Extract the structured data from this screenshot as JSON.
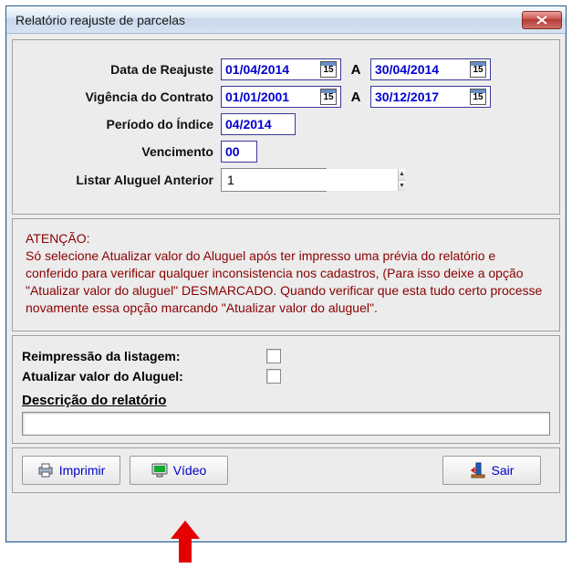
{
  "window": {
    "title": "Relatório reajuste de parcelas"
  },
  "form": {
    "data_reajuste": {
      "label": "Data de Reajuste",
      "from": "01/04/2014",
      "to": "30/04/2014",
      "sep": "A"
    },
    "vigencia": {
      "label": "Vigência do Contrato",
      "from": "01/01/2001",
      "to": "30/12/2017",
      "sep": "A"
    },
    "periodo_indice": {
      "label": "Período do Índice",
      "value": "04/2014"
    },
    "vencimento": {
      "label": "Vencimento",
      "value": "00"
    },
    "listar_anterior": {
      "label": "Listar Aluguel Anterior",
      "value": "1"
    }
  },
  "warn": {
    "heading": "ATENÇÃO:",
    "body": "Só selecione Atualizar valor do Aluguel após ter impresso uma prévia do relatório e conferido para verificar qualquer inconsistencia nos cadastros, (Para isso deixe a opção \"Atualizar valor do aluguel\" DESMARCADO. Quando verificar que esta tudo certo processe novamente essa opção marcando \"Atualizar valor do aluguel\"."
  },
  "options": {
    "reimpressao": {
      "label": "Reimpressão da listagem:"
    },
    "atualizar": {
      "label": "Atualizar valor do Aluguel:"
    },
    "descricao": {
      "label": "Descrição do relatório",
      "value": ""
    }
  },
  "buttons": {
    "imprimir": "Imprimir",
    "video": "Vídeo",
    "sair": "Sair"
  },
  "icons": {
    "calendar_day": "15"
  }
}
